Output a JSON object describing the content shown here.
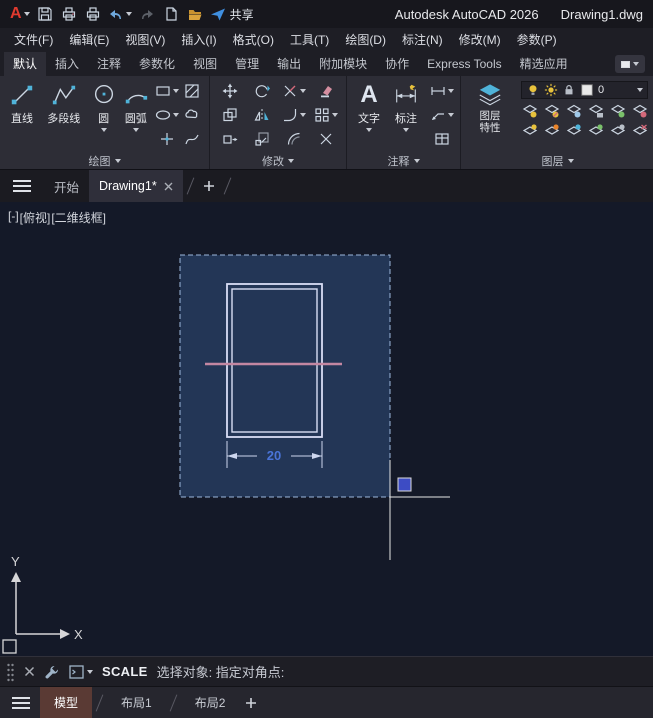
{
  "titlebar": {
    "logo": "A",
    "share_label": "共享",
    "app_title": "Autodesk AutoCAD 2026",
    "doc_title": "Drawing1.dwg"
  },
  "menubar": {
    "items": [
      "文件(F)",
      "编辑(E)",
      "视图(V)",
      "插入(I)",
      "格式(O)",
      "工具(T)",
      "绘图(D)",
      "标注(N)",
      "修改(M)",
      "参数(P)"
    ]
  },
  "ribbon": {
    "tabs": [
      "默认",
      "插入",
      "注释",
      "参数化",
      "视图",
      "管理",
      "输出",
      "附加模块",
      "协作",
      "Express Tools",
      "精选应用"
    ],
    "active_tab": "默认",
    "panels": {
      "draw": {
        "label": "绘图",
        "tools": [
          "直线",
          "多段线",
          "圆",
          "圆弧"
        ]
      },
      "modify": {
        "label": "修改"
      },
      "annotation": {
        "label": "注释",
        "tools": [
          "文字",
          "标注"
        ]
      },
      "layers": {
        "label": "图层",
        "tool_line1": "图层",
        "tool_line2": "特性",
        "current_layer": "0"
      }
    }
  },
  "filetabs": {
    "start": "开始",
    "drawing": "Drawing1*"
  },
  "viewport": {
    "controls": [
      "[-]",
      "[俯视]",
      "[二维线框]"
    ]
  },
  "canvas": {
    "dimension_text": "20",
    "ucs_x": "X",
    "ucs_y": "Y"
  },
  "commandline": {
    "command": "SCALE",
    "prompt": "选择对象: 指定对角点:"
  },
  "statusbar": {
    "model": "模型",
    "layout1": "布局1",
    "layout2": "布局2"
  },
  "colors": {
    "canvas_bg": "#141928",
    "selection_fill": "#2c4a7a",
    "selection_border": "#9db8dc",
    "geometry": "#d9def5",
    "pink_line": "#c387a2",
    "dimension_text": "#4a74d8",
    "accent_blue": "#4a90d9",
    "icon_teal": "#4fb3d9",
    "yellow": "#e8c23c",
    "red_tool": "#d4697a",
    "logo_red": "#e03a2f"
  }
}
